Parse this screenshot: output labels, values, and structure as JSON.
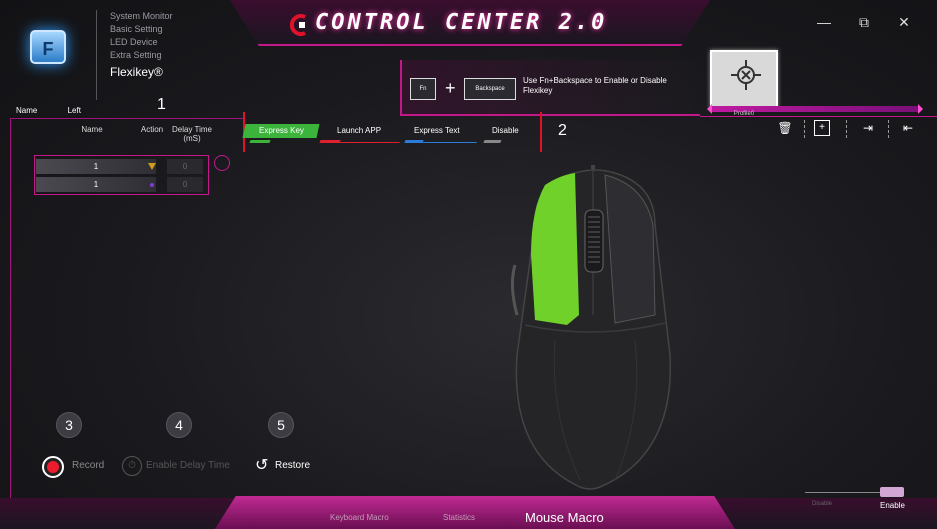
{
  "app": {
    "title": "CONTROL CENTER 2.0",
    "icon_letter": "F"
  },
  "nav": {
    "items": [
      "System Monitor",
      "Basic Setting",
      "LED Device",
      "Extra Setting"
    ],
    "active": "Flexikey®"
  },
  "window": {
    "minimize": "—",
    "restore": "⧉",
    "close": "✕"
  },
  "profile": {
    "label": "Profile0"
  },
  "flexikey_hint": {
    "key1": "Fn",
    "plus": "+",
    "key2": "Backspace",
    "text": "Use Fn+Backspace to Enable or Disable Flexikey"
  },
  "left_panel": {
    "name_label": "Name",
    "name_value": "Left",
    "columns": [
      "Name",
      "Action",
      "Delay Time (mS)"
    ],
    "rows": [
      {
        "name": "1",
        "delay": "0"
      },
      {
        "name": "1",
        "delay": "0"
      }
    ]
  },
  "tabs": [
    "Express Key",
    "Launch APP",
    "Express Text",
    "Disable"
  ],
  "markers": [
    "1",
    "2",
    "3",
    "4",
    "5"
  ],
  "actions": {
    "record": "Record",
    "enable_delay": "Enable Delay Time",
    "restore": "Restore"
  },
  "bottom": {
    "tabs": [
      "Keyboard Macro",
      "Statistics"
    ],
    "active": "Mouse Macro",
    "disable_label": "Disable",
    "enable_label": "Enable"
  },
  "colors": {
    "accent": "#c2188a",
    "express_key": "#3cb43c",
    "launch_app": "#e02030",
    "express_text": "#2b7cd8",
    "disable": "#888888",
    "mouse_highlight": "#6fd12a"
  }
}
